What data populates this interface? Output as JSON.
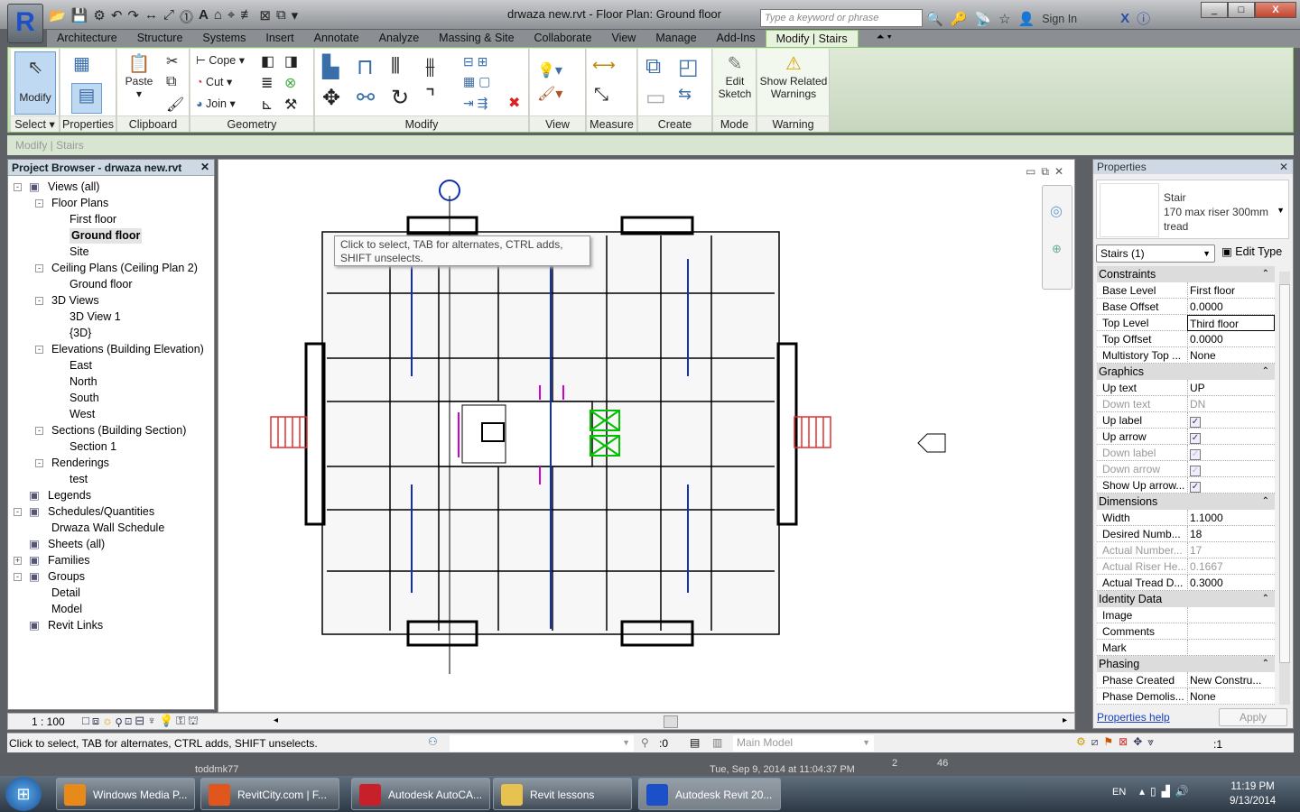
{
  "window": {
    "title": "drwaza new.rvt - Floor Plan: Ground floor",
    "app_letter": "R"
  },
  "infocenter": {
    "search_placeholder": "Type a keyword or phrase",
    "sign_in": "Sign In"
  },
  "ribbon": {
    "tabs": [
      "Architecture",
      "Structure",
      "Systems",
      "Insert",
      "Annotate",
      "Analyze",
      "Massing & Site",
      "Collaborate",
      "View",
      "Manage",
      "Add-Ins",
      "Modify | Stairs"
    ],
    "active_tab": "Modify | Stairs",
    "panels": [
      "Select",
      "Properties",
      "Clipboard",
      "Geometry",
      "Modify",
      "View",
      "Measure",
      "Create",
      "Mode",
      "Warning"
    ],
    "buttons": {
      "modify": "Modify",
      "paste": "Paste",
      "cope": "Cope",
      "cut": "Cut",
      "join": "Join",
      "edit_sketch_1": "Edit",
      "edit_sketch_2": "Sketch",
      "show_related_1": "Show Related",
      "show_related_2": "Warnings"
    }
  },
  "options_bar": {
    "context": "Modify | Stairs"
  },
  "project_browser": {
    "title": "Project Browser - drwaza new.rvt",
    "items": [
      {
        "label": "Views (all)",
        "level": 0,
        "toggle": "-"
      },
      {
        "label": "Floor Plans",
        "level": 1,
        "toggle": "-"
      },
      {
        "label": "First floor",
        "level": 2
      },
      {
        "label": "Ground floor",
        "level": 2,
        "selected": true
      },
      {
        "label": "Site",
        "level": 2
      },
      {
        "label": "Ceiling Plans (Ceiling Plan 2)",
        "level": 1,
        "toggle": "-"
      },
      {
        "label": "Ground floor",
        "level": 2
      },
      {
        "label": "3D Views",
        "level": 1,
        "toggle": "-"
      },
      {
        "label": "3D View 1",
        "level": 2
      },
      {
        "label": "{3D}",
        "level": 2
      },
      {
        "label": "Elevations (Building Elevation)",
        "level": 1,
        "toggle": "-"
      },
      {
        "label": "East",
        "level": 2
      },
      {
        "label": "North",
        "level": 2
      },
      {
        "label": "South",
        "level": 2
      },
      {
        "label": "West",
        "level": 2
      },
      {
        "label": "Sections (Building Section)",
        "level": 1,
        "toggle": "-"
      },
      {
        "label": "Section 1",
        "level": 2
      },
      {
        "label": "Renderings",
        "level": 1,
        "toggle": "-"
      },
      {
        "label": "test",
        "level": 2
      },
      {
        "label": "Legends",
        "level": 0
      },
      {
        "label": "Schedules/Quantities",
        "level": 0,
        "toggle": "-"
      },
      {
        "label": "Drwaza Wall Schedule",
        "level": 1
      },
      {
        "label": "Sheets (all)",
        "level": 0
      },
      {
        "label": "Families",
        "level": 0,
        "toggle": "+"
      },
      {
        "label": "Groups",
        "level": 0,
        "toggle": "-"
      },
      {
        "label": "Detail",
        "level": 1
      },
      {
        "label": "Model",
        "level": 1
      },
      {
        "label": "Revit Links",
        "level": 0
      }
    ]
  },
  "canvas": {
    "tooltip": "Click to select, TAB for alternates, CTRL adds, SHIFT unselects."
  },
  "properties": {
    "title": "Properties",
    "family": "Stair",
    "type": "170 max riser 300mm tread",
    "selector": "Stairs (1)",
    "edit_type": "Edit Type",
    "groups": [
      {
        "name": "Constraints",
        "rows": [
          {
            "k": "Base Level",
            "v": "First floor"
          },
          {
            "k": "Base Offset",
            "v": "0.0000"
          },
          {
            "k": "Top Level",
            "v": "Third floor",
            "active": true
          },
          {
            "k": "Top Offset",
            "v": "0.0000"
          },
          {
            "k": "Multistory Top ...",
            "v": "None"
          }
        ]
      },
      {
        "name": "Graphics",
        "rows": [
          {
            "k": "Up text",
            "v": "UP"
          },
          {
            "k": "Down text",
            "v": "DN",
            "disabled": true
          },
          {
            "k": "Up label",
            "check": true
          },
          {
            "k": "Up arrow",
            "check": true
          },
          {
            "k": "Down label",
            "check": true,
            "disabled": true
          },
          {
            "k": "Down arrow",
            "check": true,
            "disabled": true
          },
          {
            "k": "Show Up arrow...",
            "check": true
          }
        ]
      },
      {
        "name": "Dimensions",
        "rows": [
          {
            "k": "Width",
            "v": "1.1000"
          },
          {
            "k": "Desired Numb...",
            "v": "18"
          },
          {
            "k": "Actual Number...",
            "v": "17",
            "disabled": true
          },
          {
            "k": "Actual Riser He...",
            "v": "0.1667",
            "disabled": true
          },
          {
            "k": "Actual Tread D...",
            "v": "0.3000"
          }
        ]
      },
      {
        "name": "Identity Data",
        "rows": [
          {
            "k": "Image",
            "v": ""
          },
          {
            "k": "Comments",
            "v": ""
          },
          {
            "k": "Mark",
            "v": ""
          }
        ]
      },
      {
        "name": "Phasing",
        "rows": [
          {
            "k": "Phase Created",
            "v": "New Constru..."
          },
          {
            "k": "Phase Demolis...",
            "v": "None"
          }
        ]
      }
    ],
    "help_link": "Properties help",
    "apply": "Apply"
  },
  "view_control": {
    "scale": "1 : 100"
  },
  "status_bar": {
    "message": "Click to select, TAB for alternates, CTRL adds, SHIFT unselects.",
    "count": ":0",
    "model": "Main Model",
    "filter_count": ":1"
  },
  "background_page": {
    "author": "toddmk77",
    "date": "Tue, Sep 9, 2014 at 11:04:37 PM",
    "col1": "2",
    "col2": "46"
  },
  "taskbar": {
    "items": [
      {
        "label": "Windows Media P...",
        "color": "#e88a1a"
      },
      {
        "label": "RevitCity.com | F...",
        "color": "#e0561c"
      },
      {
        "label": "Autodesk AutoCA...",
        "color": "#c8202a"
      },
      {
        "label": "Revit lessons",
        "color": "#e8c250"
      },
      {
        "label": "Autodesk Revit 20...",
        "color": "#1b50c8"
      }
    ],
    "lang": "EN",
    "time": "11:19 PM",
    "date": "9/13/2014"
  },
  "colors": {
    "ribbon_accent": "#8bc56a",
    "selection_green": "#00c000",
    "stair_red": "#e03030"
  }
}
